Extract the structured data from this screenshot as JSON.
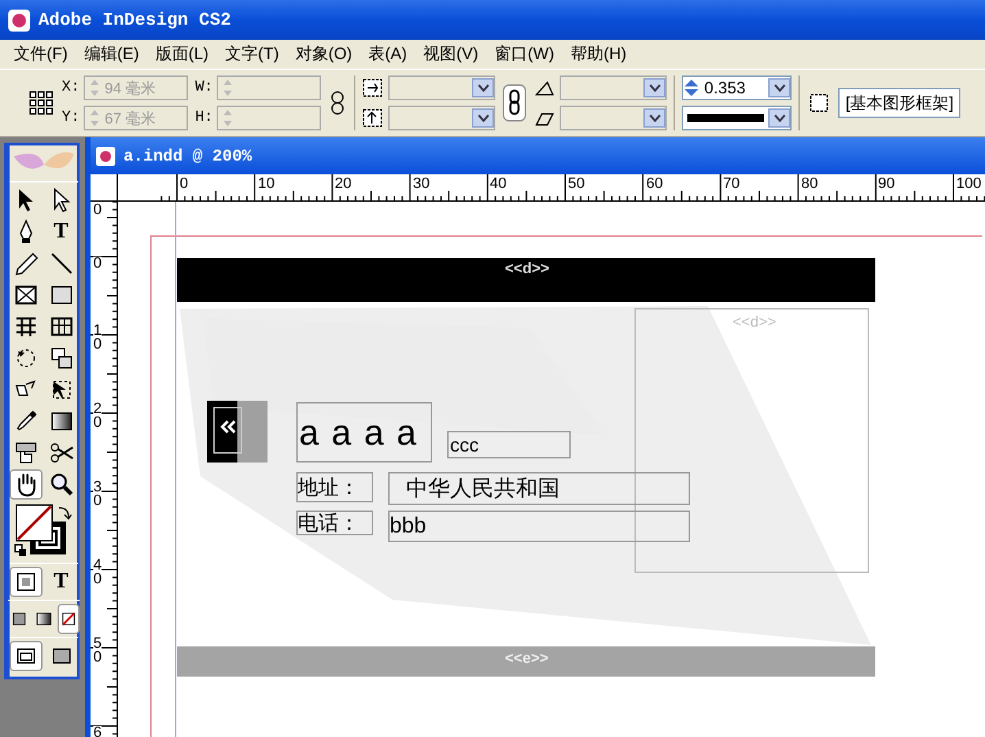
{
  "window": {
    "title": "Adobe InDesign CS2"
  },
  "menu": [
    "文件(F)",
    "编辑(E)",
    "版面(L)",
    "文字(T)",
    "对象(O)",
    "表(A)",
    "视图(V)",
    "窗口(W)",
    "帮助(H)"
  ],
  "control_panel": {
    "fields": [
      {
        "label": "X:",
        "value": "94 毫米",
        "disabled": true
      },
      {
        "label": "Y:",
        "value": "67 毫米",
        "disabled": true
      },
      {
        "label": "W:",
        "disabled": true
      },
      {
        "label": "H:",
        "disabled": true
      }
    ],
    "stroke_weight": {
      "value": "0.353"
    },
    "object_style": {
      "value": "[基本图形框架]"
    }
  },
  "toolbox": {
    "tools": [
      {
        "kind": "select",
        "selected": false
      },
      {
        "kind": "direct",
        "selected": false
      },
      {
        "kind": "pen",
        "selected": false
      },
      {
        "kind": "type",
        "label": "T",
        "selected": false
      },
      {
        "kind": "pencil",
        "selected": false
      },
      {
        "kind": "line",
        "selected": false
      },
      {
        "kind": "frame",
        "selected": false
      },
      {
        "kind": "rect",
        "selected": false
      },
      {
        "kind": "grid",
        "selected": false
      },
      {
        "kind": "table",
        "selected": false
      },
      {
        "kind": "rotate",
        "selected": false
      },
      {
        "kind": "scale",
        "selected": false
      },
      {
        "kind": "shear",
        "selected": false
      },
      {
        "kind": "transform",
        "selected": false
      },
      {
        "kind": "eyedropper",
        "selected": false
      },
      {
        "kind": "gradient",
        "selected": false
      },
      {
        "kind": "button",
        "selected": false
      },
      {
        "kind": "scissors",
        "selected": false
      },
      {
        "kind": "hand",
        "selected": true
      },
      {
        "kind": "zoom",
        "selected": false
      }
    ],
    "format_modes": [
      {
        "kind": "container",
        "selected": true
      },
      {
        "kind": "text",
        "label": "T",
        "selected": false
      }
    ],
    "apply_modes": [
      {
        "kind": "color",
        "selected": false
      },
      {
        "kind": "gradient",
        "selected": false
      },
      {
        "kind": "none",
        "selected": true
      }
    ],
    "view_modes": [
      {
        "kind": "normal",
        "selected": true
      },
      {
        "kind": "preview",
        "selected": false
      }
    ]
  },
  "document": {
    "title": "a.indd @ 200%",
    "ruler_h": [
      "0",
      "10",
      "20",
      "30",
      "40",
      "50",
      "60",
      "70",
      "80",
      "90",
      "100"
    ],
    "ruler_v": [
      "0",
      "0",
      "10",
      "20",
      "30",
      "40",
      "50",
      "6"
    ],
    "layout": {
      "header_field": "<<d>>",
      "side_field": "<<d>>",
      "heading": "a a a a",
      "tag": "ccc",
      "rows": [
        {
          "label": "地址：",
          "value": "中华人民共和国"
        },
        {
          "label": "电话：",
          "value": "bbb"
        }
      ],
      "footer_field": "<<e>>"
    }
  }
}
